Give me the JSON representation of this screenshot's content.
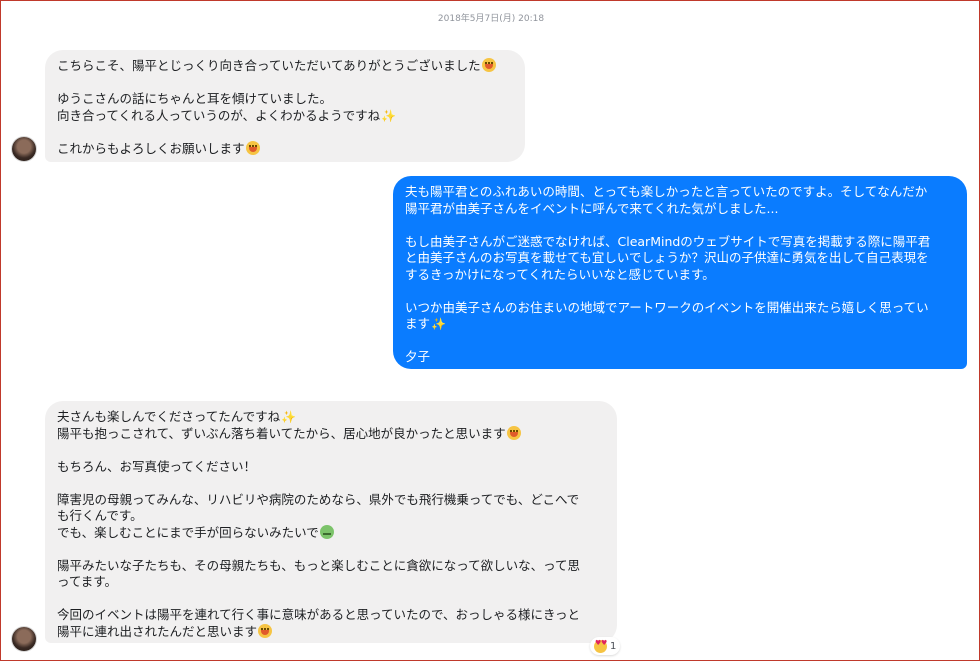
{
  "timestamp": "2018年5月7日(月) 20:18",
  "messages": {
    "m1": {
      "l1": "こちらこそ、陽平とじっくり向き合っていただいてありがとうございました",
      "l2": "ゆうこさんの話にちゃんと耳を傾けていました。",
      "l3": "向き合ってくれる人っていうのが、よくわかるようですね",
      "l4": "これからもよろしくお願いします"
    },
    "m2": {
      "l1": "夫も陽平君とのふれあいの時間、とっても楽しかったと言っていたのですよ。そしてなんだか",
      "l2": "陽平君が由美子さんをイベントに呼んで来てくれた気がしました...",
      "l3": "もし由美子さんがご迷惑でなければ、ClearMindのウェブサイトで写真を掲載する際に陽平君",
      "l4": "と由美子さんのお写真を載せても宜しいでしょうか？沢山の子供達に勇気を出して自己表現を",
      "l5": "するきっかけになってくれたらいいなと感じています。",
      "l6": "いつか由美子さんのお住まいの地域でアートワークのイベントを開催出来たら嬉しく思ってい",
      "l7": "ます",
      "l8": "夕子"
    },
    "m3": {
      "l1": "夫さんも楽しんでくださってたんですね",
      "l2": "陽平も抱っこされて、ずいぶん落ち着いてたから、居心地が良かったと思います",
      "l3": "もちろん、お写真使ってください！",
      "l4": "障害児の母親ってみんな、リハビリや病院のためなら、県外でも飛行機乗ってでも、どこへで",
      "l5": "も行くんです。",
      "l6": "でも、楽しむことにまで手が回らないみたいで",
      "l7": "陽平みたいな子たちも、その母親たちも、もっと楽しむことに貪欲になって欲しいな、って思",
      "l8": "ってます。",
      "l9": "今回のイベントは陽平を連れて行く事に意味があると思っていたので、おっしゃる様にきっと",
      "l10": "陽平に連れ出されたんだと思います"
    }
  },
  "reaction": {
    "icon": "heart-eyes-emoji",
    "count": "1"
  },
  "colors": {
    "outgoing": "#0a7cff",
    "incoming": "#f1f0f0",
    "text": "#1c1e21"
  }
}
